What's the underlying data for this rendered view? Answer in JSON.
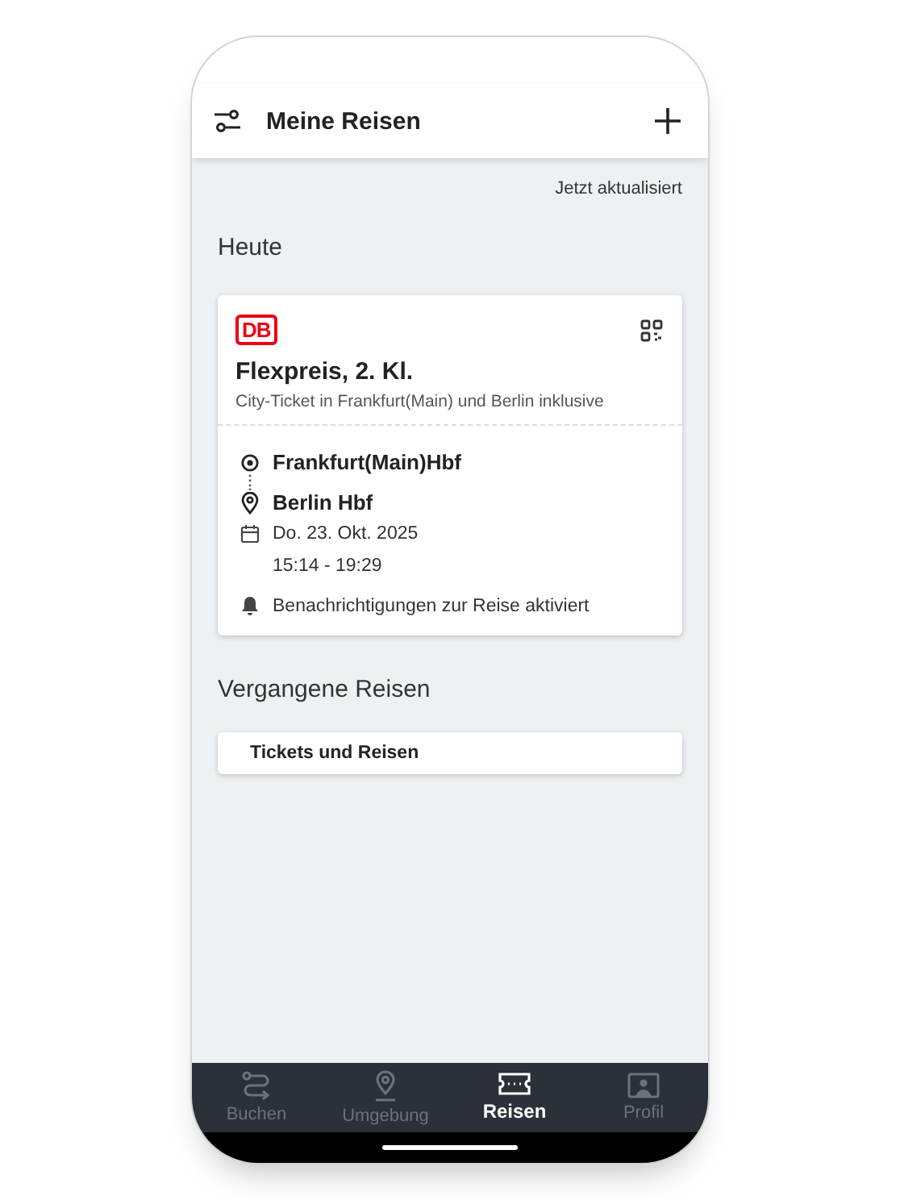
{
  "header": {
    "title": "Meine Reisen"
  },
  "updated": "Jetzt aktualisiert",
  "today": {
    "heading": "Heute",
    "ticket": {
      "logo": "DB",
      "title": "Flexpreis, 2. Kl.",
      "subtitle": "City-Ticket in Frankfurt(Main) und Berlin inklusive",
      "origin": "Frankfurt(Main)Hbf",
      "destination": "Berlin Hbf",
      "date": "Do. 23. Okt. 2025",
      "time": "15:14 - 19:29",
      "notification": "Benachrichtigungen zur Reise aktiviert"
    }
  },
  "past": {
    "heading": "Vergangene Reisen",
    "button": "Tickets und Reisen"
  },
  "nav": [
    {
      "label": "Buchen",
      "kind": "route",
      "selected": false
    },
    {
      "label": "Umgebung",
      "kind": "location",
      "selected": false
    },
    {
      "label": "Reisen",
      "kind": "ticket",
      "selected": true
    },
    {
      "label": "Profil",
      "kind": "profile",
      "selected": false
    }
  ]
}
